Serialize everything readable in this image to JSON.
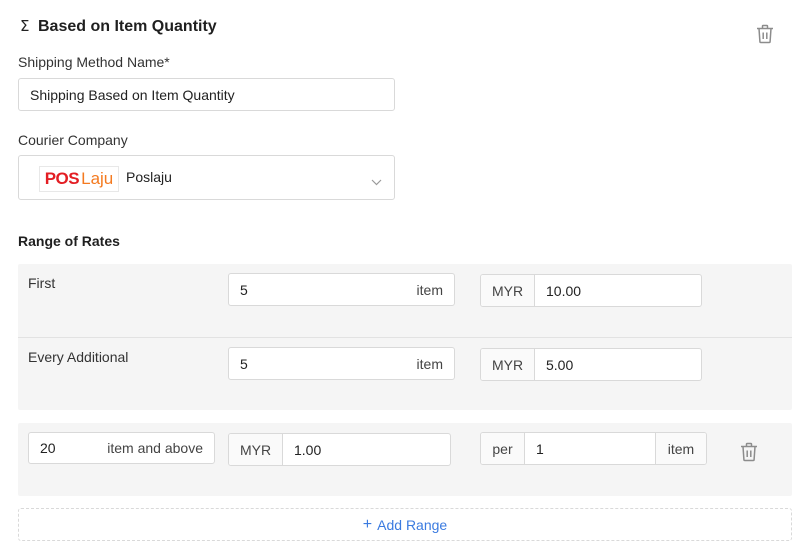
{
  "header": {
    "sigma": "Σ",
    "title": "Based on Item Quantity"
  },
  "shipping_method": {
    "label": "Shipping Method Name*",
    "value": "Shipping Based on Item Quantity"
  },
  "courier": {
    "label": "Courier Company",
    "logo_text_1": "POS",
    "logo_text_2": "Laju",
    "selected": "Poslaju"
  },
  "range_of_rates": {
    "title": "Range of Rates",
    "rows": [
      {
        "label": "First",
        "qty": "5",
        "unit": "item",
        "currency": "MYR",
        "amount": "10.00"
      },
      {
        "label": "Every Additional",
        "qty": "5",
        "unit": "item",
        "currency": "MYR",
        "amount": "5.00"
      }
    ],
    "above": {
      "qty": "20",
      "qty_suffix": "item and above",
      "currency": "MYR",
      "amount": "1.00",
      "per_label": "per",
      "per_value": "1",
      "per_unit": "item"
    }
  },
  "add_range": {
    "icon": "+",
    "label": "Add Range"
  },
  "colors": {
    "accent": "#3b7be0",
    "panel_bg": "#f5f5f5",
    "border": "#d9d9d9",
    "logo_red": "#e31e24",
    "logo_orange": "#f47a20"
  }
}
